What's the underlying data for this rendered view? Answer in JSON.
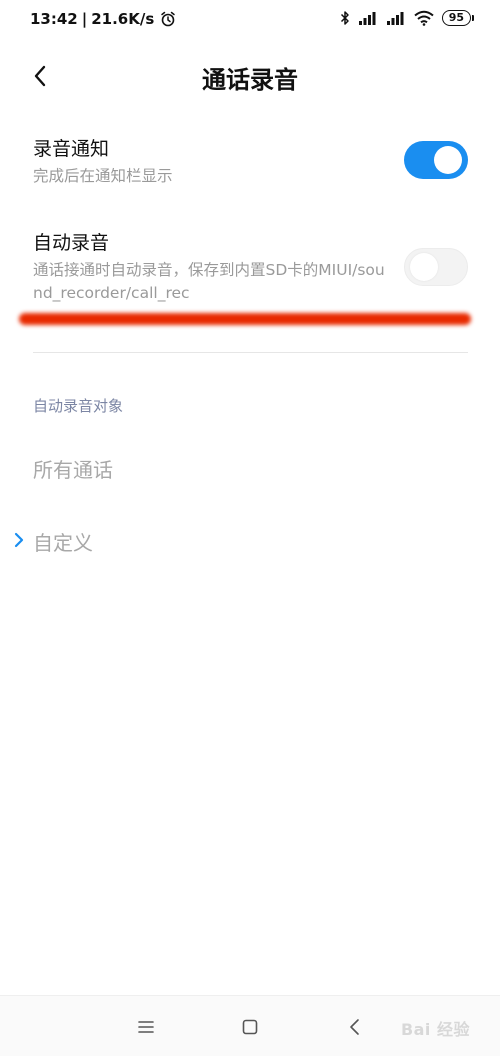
{
  "status_bar": {
    "time": "13:42",
    "separator": "|",
    "speed": "21.6K/s",
    "battery": "95"
  },
  "header": {
    "title": "通话录音"
  },
  "settings": [
    {
      "title": "录音通知",
      "description": "完成后在通知栏显示",
      "enabled": true
    },
    {
      "title": "自动录音",
      "description": "通话接通时自动录音，保存到内置SD卡的MIUI/sound_recorder/call_rec",
      "enabled": false
    }
  ],
  "section": {
    "header": "自动录音对象",
    "options": [
      {
        "label": "所有通话",
        "selected": false
      },
      {
        "label": "自定义",
        "selected": true
      }
    ]
  },
  "watermark": "Bai 经验",
  "colors": {
    "accent": "#1a8ef0",
    "annotation_red": "#e82a00",
    "section_header": "#7c86a4"
  }
}
